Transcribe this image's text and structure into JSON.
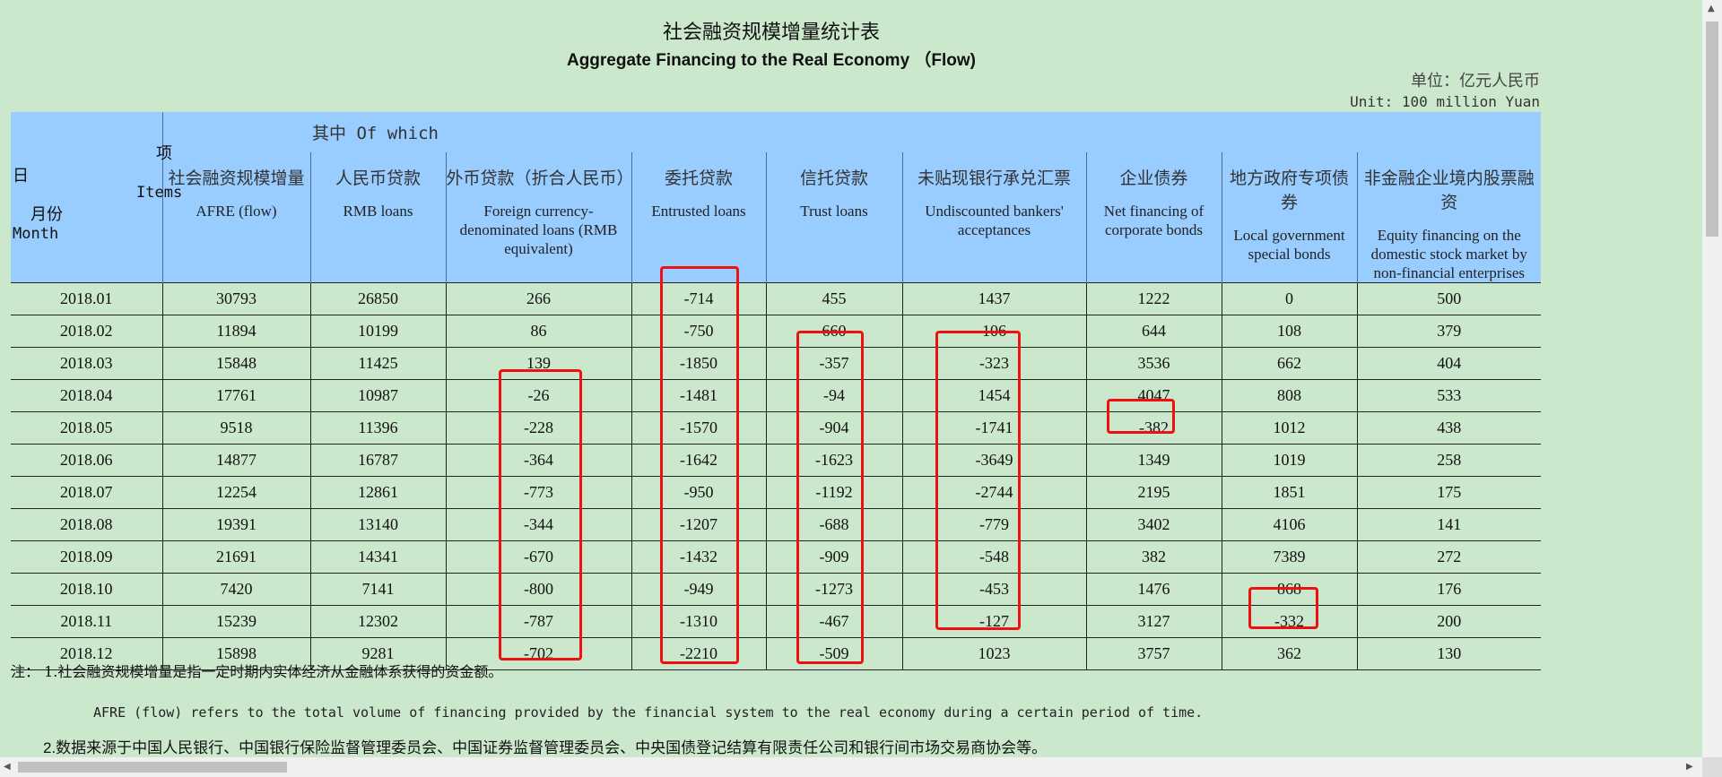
{
  "title_cn": "社会融资规模增量统计表",
  "title_en": "Aggregate Financing to the Real Economy （Flow)",
  "unit_cn": "单位：亿元人民币",
  "unit_en": "Unit: 100 million Yuan",
  "header": {
    "of_which": "其中 Of which",
    "item_cn": "项",
    "item_en": "Items",
    "month_ri": "日",
    "month_cn": "月份",
    "month_en": "Month",
    "columns": [
      {
        "cn": "社会融资规模增量",
        "en": "AFRE (flow)"
      },
      {
        "cn": "人民币贷款",
        "en": "RMB loans"
      },
      {
        "cn": "外币贷款（折合人民币）",
        "en": "Foreign currency-denominated loans (RMB equivalent)"
      },
      {
        "cn": "委托贷款",
        "en": "Entrusted loans"
      },
      {
        "cn": "信托贷款",
        "en": "Trust loans"
      },
      {
        "cn": "未贴现银行承兑汇票",
        "en": "Undiscounted bankers' acceptances"
      },
      {
        "cn": "企业债券",
        "en": "Net financing of corporate bonds"
      },
      {
        "cn": "地方政府专项债券",
        "en": "Local government special bonds"
      },
      {
        "cn": "非金融企业境内股票融资",
        "en": "Equity financing on the domestic stock market by non-financial enterprises"
      }
    ]
  },
  "rows": [
    {
      "month": "2018.01",
      "afre": "30793",
      "rmb": "26850",
      "fx": "266",
      "entrusted": "-714",
      "trust": "455",
      "undiscounted": "1437",
      "corp_bonds": "1222",
      "local_gov": "0",
      "equity": "500"
    },
    {
      "month": "2018.02",
      "afre": "11894",
      "rmb": "10199",
      "fx": "86",
      "entrusted": "-750",
      "trust": "660",
      "undiscounted": "106",
      "corp_bonds": "644",
      "local_gov": "108",
      "equity": "379"
    },
    {
      "month": "2018.03",
      "afre": "15848",
      "rmb": "11425",
      "fx": "139",
      "entrusted": "-1850",
      "trust": "-357",
      "undiscounted": "-323",
      "corp_bonds": "3536",
      "local_gov": "662",
      "equity": "404"
    },
    {
      "month": "2018.04",
      "afre": "17761",
      "rmb": "10987",
      "fx": "-26",
      "entrusted": "-1481",
      "trust": "-94",
      "undiscounted": "1454",
      "corp_bonds": "4047",
      "local_gov": "808",
      "equity": "533"
    },
    {
      "month": "2018.05",
      "afre": "9518",
      "rmb": "11396",
      "fx": "-228",
      "entrusted": "-1570",
      "trust": "-904",
      "undiscounted": "-1741",
      "corp_bonds": "-382",
      "local_gov": "1012",
      "equity": "438"
    },
    {
      "month": "2018.06",
      "afre": "14877",
      "rmb": "16787",
      "fx": "-364",
      "entrusted": "-1642",
      "trust": "-1623",
      "undiscounted": "-3649",
      "corp_bonds": "1349",
      "local_gov": "1019",
      "equity": "258"
    },
    {
      "month": "2018.07",
      "afre": "12254",
      "rmb": "12861",
      "fx": "-773",
      "entrusted": "-950",
      "trust": "-1192",
      "undiscounted": "-2744",
      "corp_bonds": "2195",
      "local_gov": "1851",
      "equity": "175"
    },
    {
      "month": "2018.08",
      "afre": "19391",
      "rmb": "13140",
      "fx": "-344",
      "entrusted": "-1207",
      "trust": "-688",
      "undiscounted": "-779",
      "corp_bonds": "3402",
      "local_gov": "4106",
      "equity": "141"
    },
    {
      "month": "2018.09",
      "afre": "21691",
      "rmb": "14341",
      "fx": "-670",
      "entrusted": "-1432",
      "trust": "-909",
      "undiscounted": "-548",
      "corp_bonds": "382",
      "local_gov": "7389",
      "equity": "272"
    },
    {
      "month": "2018.10",
      "afre": "7420",
      "rmb": "7141",
      "fx": "-800",
      "entrusted": "-949",
      "trust": "-1273",
      "undiscounted": "-453",
      "corp_bonds": "1476",
      "local_gov": "868",
      "equity": "176"
    },
    {
      "month": "2018.11",
      "afre": "15239",
      "rmb": "12302",
      "fx": "-787",
      "entrusted": "-1310",
      "trust": "-467",
      "undiscounted": "-127",
      "corp_bonds": "3127",
      "local_gov": "-332",
      "equity": "200"
    },
    {
      "month": "2018.12",
      "afre": "15898",
      "rmb": "9281",
      "fx": "-702",
      "entrusted": "-2210",
      "trust": "-509",
      "undiscounted": "1023",
      "corp_bonds": "3757",
      "local_gov": "362",
      "equity": "130"
    }
  ],
  "notes": {
    "note1_cn": "注： 1.社会融资规模增量是指一定时期内实体经济从金融体系获得的资金额。",
    "note1_en": "AFRE (flow) refers to the total volume of financing provided by the financial system to the real economy during a certain period of time.",
    "note2_cn": "2.数据来源于中国人民银行、中国银行保险监督管理委员会、中国证券监督管理委员会、中央国债登记结算有限责任公司和银行间市场交易商协会等。"
  },
  "highlight_color": "#ee1111"
}
